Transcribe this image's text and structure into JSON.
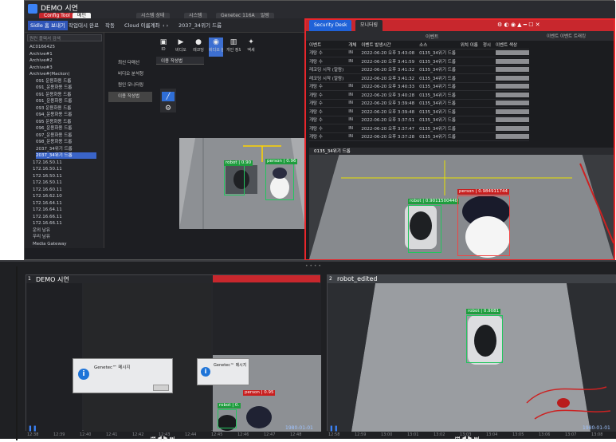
{
  "app": {
    "title": "DEMO 시연",
    "tabs": [
      "Config Tool",
      "메인",
      "시스템 상태",
      "시스템",
      "Genetec 116A",
      "알람",
      "모니터링"
    ]
  },
  "toolbar": {
    "items": [
      "Sidle 홈 보내기",
      "작업대시 완료",
      "작동",
      "Cloud 이름계좌",
      "2037_34위기 드롭"
    ]
  },
  "tree": {
    "search_placeholder": "원컨 플렉셔 검색",
    "rows": [
      "AC0166425",
      "Archive#1",
      "Archive#2",
      "Archive#3",
      "Archive#(Mackon)",
      "091 운용화용 드롭",
      "091_운용화용 드롭",
      "091 운용화용 드롭",
      "091_운용화용 드롭",
      "093 운용화용 드롭",
      "094_운용화용 드롭",
      "095 운용화용 드롭",
      "096_운용화용 드롭",
      "097_운용화용 드롭",
      "098_운용화용 드롭",
      "2037_34위기 드롭",
      "2037_34위기 드롭",
      "172.16.50.11",
      "172.16.50.11",
      "172.16.50.11",
      "172.16.50.11",
      "172.16.60.11",
      "172.16.62.10",
      "172.16.64.11",
      "172.16.64.11",
      "172.16.66.11",
      "172.16.66.11",
      "운외 남유",
      "우리 남유",
      "Media Gateway"
    ]
  },
  "sidemenu": [
    "최신 다매선",
    "비디오 분석청",
    "원인 모니터링",
    "이용 작성법"
  ],
  "editor_tab": "이용 작성법",
  "iconbar": [
    {
      "label": "ID",
      "glyph": "▣"
    },
    {
      "label": "비디오",
      "glyph": "▶"
    },
    {
      "label": "레코딩",
      "glyph": "●"
    },
    {
      "label": "비디오 분석",
      "glyph": "◉"
    },
    {
      "label": "개인 정보 보호",
      "glyph": "▥"
    },
    {
      "label": "액세",
      "glyph": "✦"
    }
  ],
  "security_desk": {
    "title": "Security Desk",
    "tab": "모니터링",
    "event_header": "이벤트",
    "right_header": "이벤트 이벤트 트래킹",
    "columns": [
      "이벤트",
      "개체",
      "이벤트 발생시간",
      "소스",
      "위치 이름",
      "정시",
      "이벤트 색상"
    ],
    "rows": [
      [
        "개탕 수",
        "IN",
        "2022-06-20 오후 3:43:08",
        "0135_34위기 드롭"
      ],
      [
        "개탕 수",
        "IN",
        "2022-06-20 오후 3:41:59",
        "0135_34위기 드롭"
      ],
      [
        "레코딩 시작 (알람)",
        "",
        "2022-06-20 오후 3:41:32",
        "0135_34위기 드롭"
      ],
      [
        "레코딩 시작 (알람)",
        "",
        "2022-06-20 오후 3:41:32",
        "0135_34위기 드롭"
      ],
      [
        "개탕 수",
        "IN",
        "2022-06-20 오후 3:40:33",
        "0135_34위기 드롭"
      ],
      [
        "개탕 수",
        "IN",
        "2022-06-20 오후 3:40:28",
        "0135_34위기 드롭"
      ],
      [
        "개탕 수",
        "IN",
        "2022-06-20 오후 3:39:48",
        "0135_34위기 드롭"
      ],
      [
        "개탕 수",
        "IN",
        "2022-06-20 오후 3:39:48",
        "0135_34위기 드롭"
      ],
      [
        "개탕 수",
        "IN",
        "2022-06-20 오후 3:37:51",
        "0135_34위기 드롭"
      ],
      [
        "개탕 수",
        "IN",
        "2022-06-20 오후 3:37:47",
        "0135_34위기 드롭"
      ],
      [
        "개탕 수",
        "IN",
        "2022-06-20 오후 3:37:28",
        "0135_34위기 드롭"
      ]
    ],
    "camera_tile": "0135_34위기 드롭"
  },
  "detections": {
    "robot_top": "robot | 0.90",
    "person_top": "person | 0.96",
    "robot_main": "robot | 0.9011500440",
    "person_main": "person | 0.984911744",
    "robot_bl": "robot | 0.",
    "person_bl": "person | 0.95",
    "robot_br": "robot | 0.9081"
  },
  "bottom": {
    "left_title": "DEMO 시연",
    "right_title": "robot_edited",
    "left_index": "1",
    "right_index": "2",
    "dialog1_title": "Genetec™ 메시지",
    "dialog2_title": "Genetec™ 메시지",
    "date_left": "1980-01-01",
    "date_right": "1980-01-01",
    "timeline_left": [
      "12:38",
      "12:39",
      "12:40",
      "12:41",
      "12:42",
      "12:43",
      "12:44",
      "12:45",
      "12:46",
      "12:47",
      "12:48"
    ],
    "timeline_right": [
      "12:58",
      "12:59",
      "13:00",
      "13:01",
      "13:02",
      "13:03",
      "13:04",
      "13:05",
      "13:06",
      "13:07",
      "13:08"
    ]
  },
  "colors": {
    "accent_red": "#e8262b",
    "detect_green": "#22c55e",
    "detect_red": "#ef4444",
    "select_blue": "#3d6fd1"
  }
}
